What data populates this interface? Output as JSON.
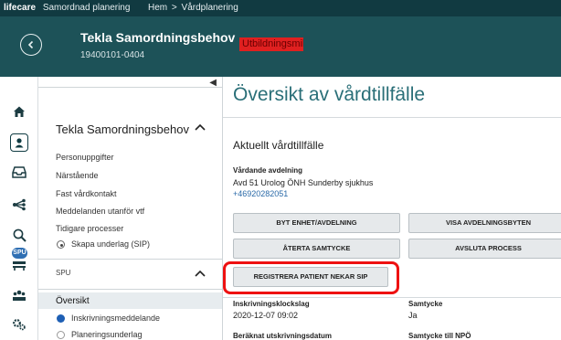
{
  "topbar": {
    "brand": "lifecare",
    "module": "Samordnad planering",
    "breadcrumb_home": "Hem",
    "breadcrumb_sep": ">",
    "breadcrumb_current": "Vårdplanering"
  },
  "patient": {
    "name": "Tekla Samordningsbehov",
    "id": "19400101-0404",
    "flag_text": "Utbildningsmiljö"
  },
  "sidebar": {
    "title": "Tekla Samordningsbehov",
    "items": [
      "Personuppgifter",
      "Närstående",
      "Fast vårdkontakt",
      "Meddelanden utanför vtf",
      "Tidigare processer"
    ],
    "sip_action": "Skapa underlag (SIP)",
    "section_label": "SPU",
    "active_item": "Översikt",
    "sub_items": [
      "Inskrivningsmeddelande",
      "Planeringsunderlag"
    ],
    "spu_badge": "SPU"
  },
  "main": {
    "title": "Översikt av vårdtillfälle",
    "subtitle": "Aktuellt vårdtillfälle",
    "ward_label": "Vårdande avdelning",
    "ward_value": "Avd 51 Urolog ÖNH Sunderby sjukhus",
    "phone": "+46920282051",
    "buttons": {
      "change_unit": "BYT ENHET/AVDELNING",
      "show_changes": "VISA AVDELNINGSBYTEN",
      "revoke_consent": "ÅTERTA SAMTYCKE",
      "end_process": "AVSLUTA PROCESS",
      "register_refusal": "REGISTRERA PATIENT NEKAR SIP"
    },
    "admission_time_label": "Inskrivningsklockslag",
    "admission_time_value": "2020-12-07 09:02",
    "consent_label": "Samtycke",
    "consent_value": "Ja",
    "discharge_label": "Beräknat utskrivningsdatum",
    "npo_consent_label": "Samtycke till NPÖ"
  },
  "colors": {
    "topbar": "#113a41",
    "patient_bar": "#1d5258",
    "accent": "#2a6f78",
    "flag": "#e02020",
    "highlight": "#ee1111",
    "badge": "#2f6fb3"
  }
}
